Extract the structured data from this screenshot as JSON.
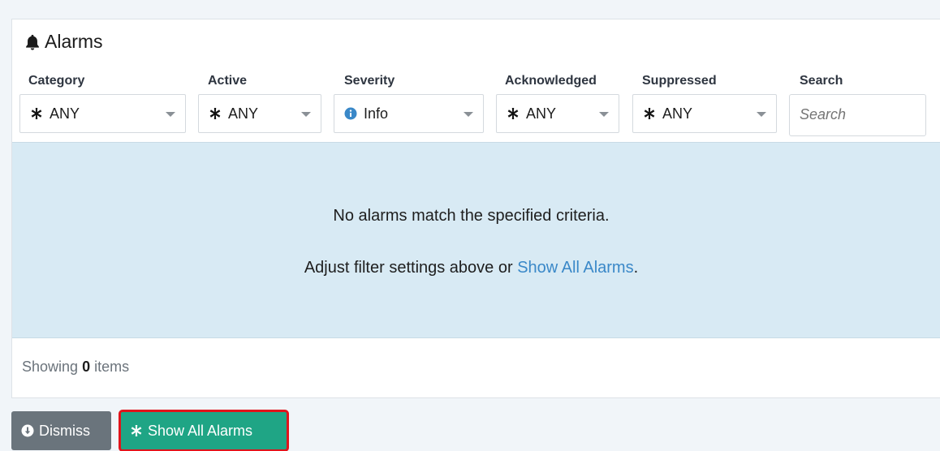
{
  "title": "Alarms",
  "filters": {
    "category": {
      "label": "Category",
      "value": "ANY"
    },
    "active": {
      "label": "Active",
      "value": "ANY"
    },
    "severity": {
      "label": "Severity",
      "value": "Info"
    },
    "acknowledged": {
      "label": "Acknowledged",
      "value": "ANY"
    },
    "suppressed": {
      "label": "Suppressed",
      "value": "ANY"
    },
    "search": {
      "label": "Search",
      "placeholder": "Search"
    }
  },
  "empty_state": {
    "message": "No alarms match the specified criteria.",
    "hint_prefix": "Adjust filter settings above or ",
    "hint_link": "Show All Alarms",
    "hint_suffix": "."
  },
  "footer": {
    "prefix": "Showing ",
    "count": "0",
    "suffix": " items"
  },
  "buttons": {
    "dismiss": "Dismiss",
    "show_all": "Show All Alarms"
  },
  "colors": {
    "show_all_bg": "#1fa585",
    "dismiss_bg": "#6a747c",
    "link": "#3a88c8",
    "highlight": "#e1141b",
    "empty_bg": "#d8eaf4"
  },
  "icons": {
    "title": "bell-icon",
    "any": "asterisk-icon",
    "severity": "info-circle-icon",
    "dismiss": "arrow-circle-down-icon",
    "show_all": "asterisk-icon"
  }
}
